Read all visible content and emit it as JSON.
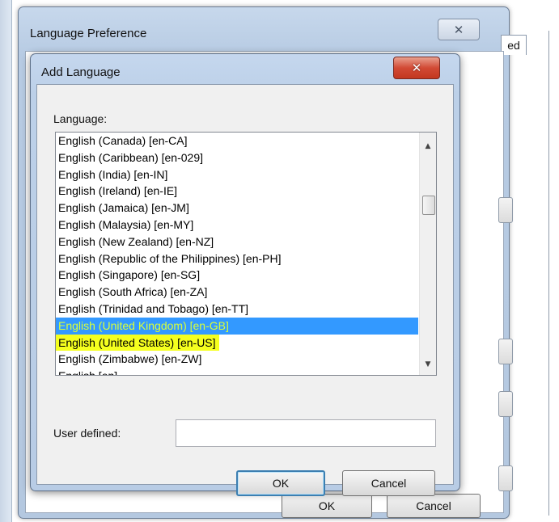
{
  "outer_window": {
    "title": "Language Preference",
    "close_glyph": "✕",
    "partial_tab_label": "ed",
    "ok_label": "OK",
    "cancel_label": "Cancel"
  },
  "dialog": {
    "title": "Add Language",
    "close_glyph": "✕",
    "language_label": "Language:",
    "languages": [
      "English (Canada) [en-CA]",
      "English (Caribbean) [en-029]",
      "English (India) [en-IN]",
      "English (Ireland) [en-IE]",
      "English (Jamaica) [en-JM]",
      "English (Malaysia) [en-MY]",
      "English (New Zealand) [en-NZ]",
      "English (Republic of the Philippines) [en-PH]",
      "English (Singapore) [en-SG]",
      "English (South Africa) [en-ZA]",
      "English (Trinidad and Tobago) [en-TT]",
      "English (United Kingdom) [en-GB]",
      "English (United States) [en-US]",
      "English (Zimbabwe) [en-ZW]",
      "English [en]"
    ],
    "selected_language": "English (United Kingdom) [en-GB]",
    "highlighted_language": "English (United States) [en-US]",
    "user_defined_label": "User defined:",
    "user_defined_value": "",
    "ok_label": "OK",
    "cancel_label": "Cancel"
  },
  "colors": {
    "selection": "#3399ff",
    "highlighter": "#f5ff1e",
    "close_button": "#d24a35"
  }
}
